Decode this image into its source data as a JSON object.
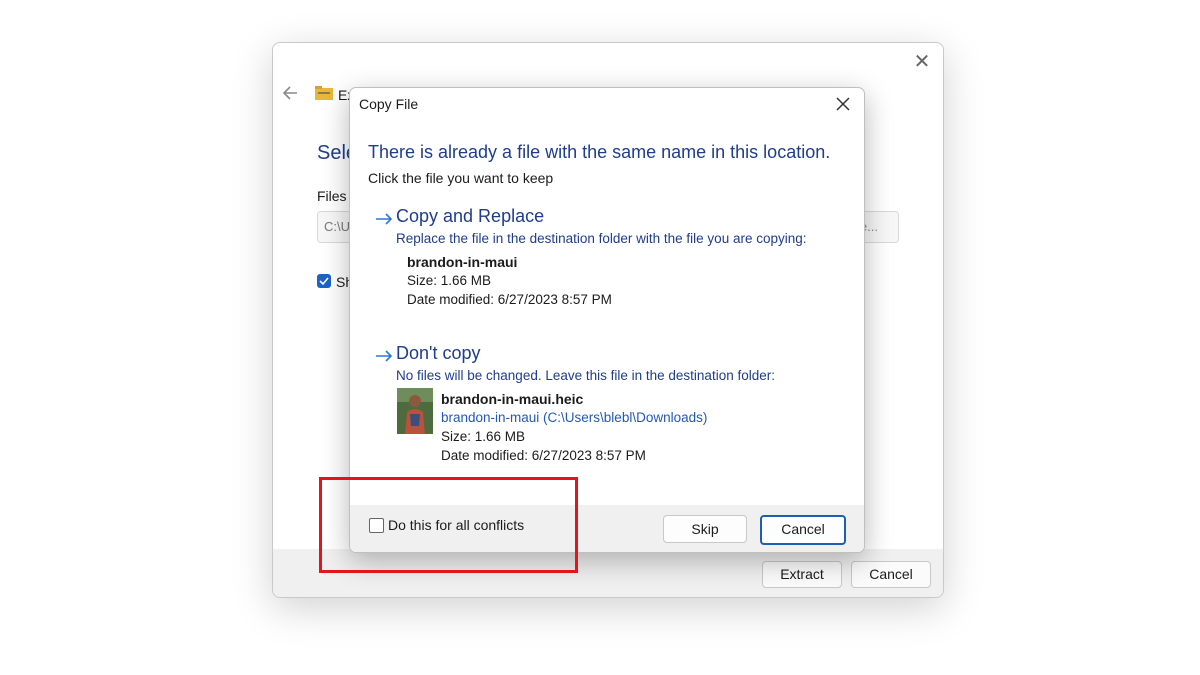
{
  "wizard": {
    "title_partial": "Ex",
    "heading_partial": "Sele",
    "files_label_partial": "Files v",
    "path_partial": "C:\\U",
    "browse_partial": "e...",
    "show_partial": "Sh",
    "extract_label": "Extract",
    "cancel_label": "Cancel"
  },
  "dialog": {
    "title": "Copy File",
    "heading": "There is already a file with the same name in this location.",
    "subheading": "Click the file you want to keep",
    "option_replace": {
      "title": "Copy and Replace",
      "description": "Replace the file in the destination folder with the file you are copying:",
      "file_name": "brandon-in-maui",
      "size": "Size: 1.66 MB",
      "date": "Date modified: 6/27/2023 8:57 PM"
    },
    "option_skip": {
      "title": "Don't copy",
      "description": "No files will be changed. Leave this file in the destination folder:",
      "file_name": "brandon-in-maui.heic",
      "location": "brandon-in-maui (C:\\Users\\blebl\\Downloads)",
      "size": "Size: 1.66 MB",
      "date": "Date modified: 6/27/2023 8:57 PM"
    },
    "all_conflicts_label": "Do this for all conflicts",
    "all_conflicts_checked": false,
    "skip_label": "Skip",
    "cancel_label": "Cancel"
  },
  "colors": {
    "accent_blue": "#1f3d8a",
    "link_blue": "#2458b4",
    "highlight_red": "#e2151b"
  }
}
